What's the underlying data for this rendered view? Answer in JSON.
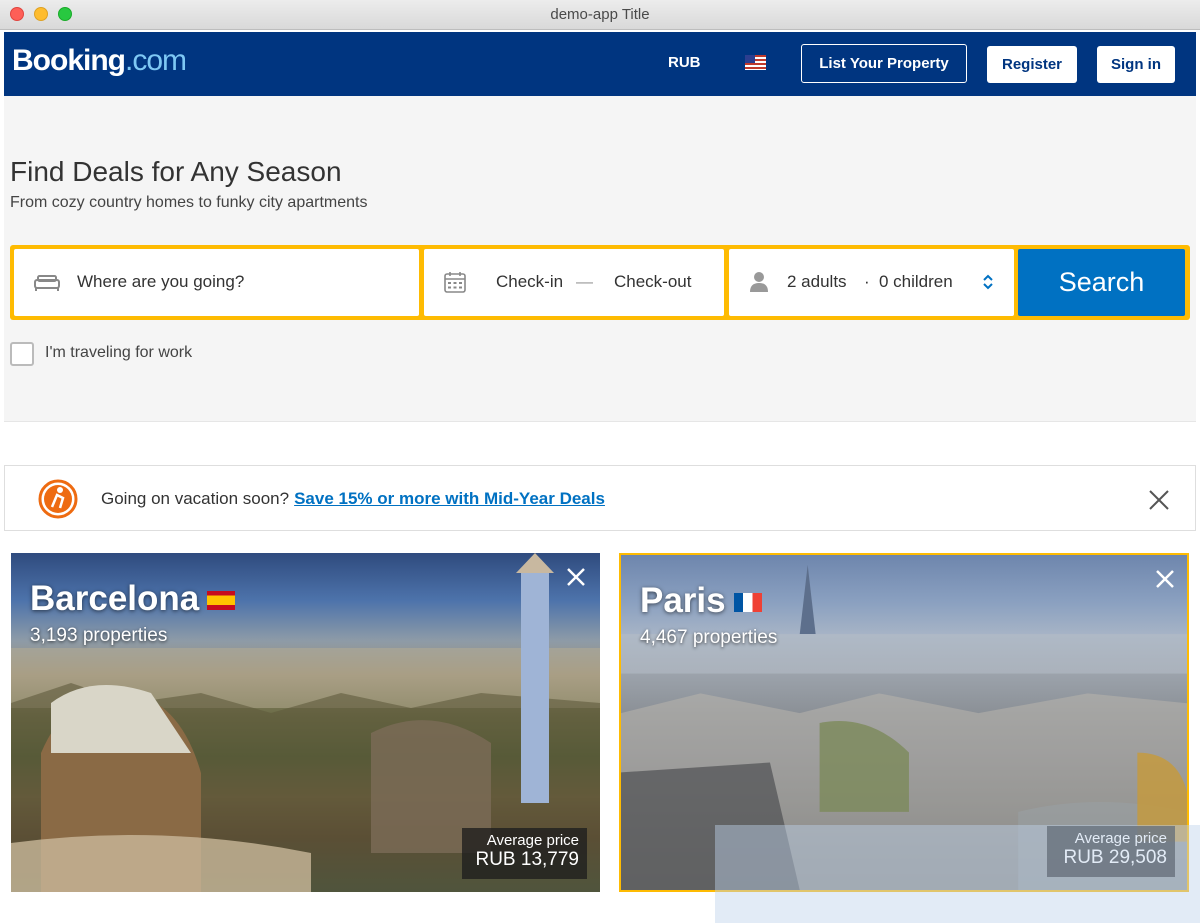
{
  "window": {
    "title": "demo-app Title"
  },
  "header": {
    "logo_brand": "Booking",
    "logo_tld": ".com",
    "currency": "RUB",
    "list_property": "List Your Property",
    "register": "Register",
    "sign_in": "Sign in"
  },
  "hero": {
    "title": "Find Deals for Any Season",
    "subtitle": "From cozy country homes to funky city apartments"
  },
  "search": {
    "destination_placeholder": "Where are you going?",
    "checkin": "Check-in",
    "dash": "—",
    "checkout": "Check-out",
    "adults": "2 adults",
    "dot": "·",
    "children": "0 children",
    "button": "Search",
    "work_travel_label": "I'm traveling for work"
  },
  "banner": {
    "text": "Going on vacation soon?",
    "link": "Save 15% or more with Mid-Year Deals"
  },
  "cards": [
    {
      "city": "Barcelona",
      "properties": "3,193 properties",
      "price_label": "Average price",
      "price": "RUB 13,779"
    },
    {
      "city": "Paris",
      "properties": "4,467 properties",
      "price_label": "Average price",
      "price": "RUB 29,508"
    }
  ],
  "colors": {
    "brand_blue": "#003580",
    "search_blue": "#0071c2",
    "accent_yellow": "#febb02"
  }
}
